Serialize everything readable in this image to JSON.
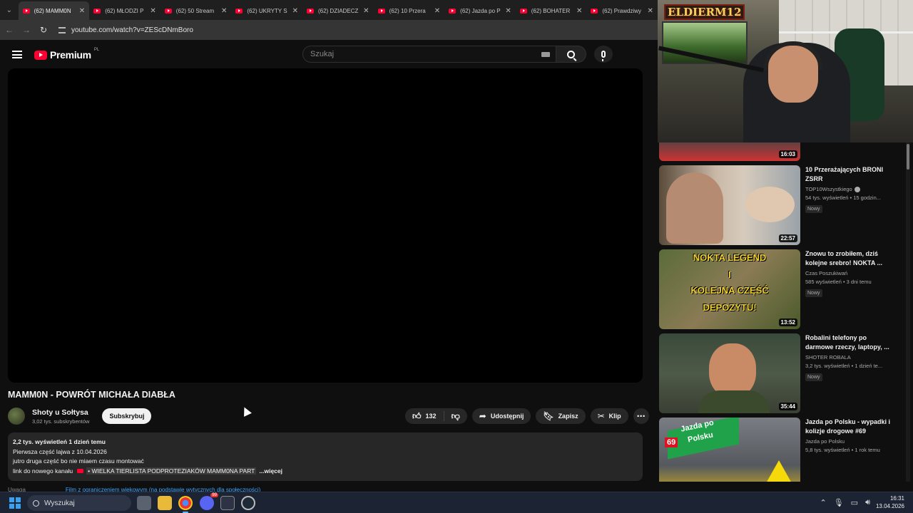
{
  "browser": {
    "tabs": [
      {
        "label": "(62) MAMM0N",
        "active": true
      },
      {
        "label": "(62) MŁODZI P",
        "active": false
      },
      {
        "label": "(62) 50 Stream",
        "active": false
      },
      {
        "label": "(62) UKRYTY S",
        "active": false
      },
      {
        "label": "(62) DZIADECZ",
        "active": false
      },
      {
        "label": "(62) 10 Przera",
        "active": false
      },
      {
        "label": "(62) Jazda po P",
        "active": false
      },
      {
        "label": "(62) BOHATER",
        "active": false
      },
      {
        "label": "(62) Prawdziwy",
        "active": false
      }
    ],
    "url": "youtube.com/watch?v=ZEScDNmBoro"
  },
  "masthead": {
    "logo_text": "Premium",
    "logo_country": "PL",
    "search_placeholder": "Szukaj"
  },
  "video": {
    "title": "MAMM0N - POWRÓT MICHAŁA DIABŁA",
    "channel_name": "Shoty u Sołtysa",
    "subscribers": "3,02 tys. subskrybentów",
    "subscribe_label": "Subskrybuj",
    "likes": "132",
    "share_label": "Udostępnij",
    "save_label": "Zapisz",
    "clip_label": "Klip"
  },
  "description": {
    "meta": "2,2 tys. wyświetleń  1 dzień temu",
    "line1": "Pierwsza część lajwa z 10.04.2026",
    "line2": "jutro druga część bo nie miaem czasu montować",
    "line3_prefix": "link do nowego kanału",
    "line3_tag": "• WIELKA TIERLISTA PODPROTEZIAKÓW MAMM0NA PART",
    "more": "...więcej"
  },
  "below": {
    "label": "Uwaga",
    "link": "Film z ograniczeniem wiekowym (na podstawie wytycznych dla społeczności)"
  },
  "webcam": {
    "watermark": "ELDIERM12"
  },
  "related": {
    "partial_duration": "16:03",
    "items": [
      {
        "title": "10 Przerażających BRONI ZSRR",
        "channel": "TOP10Wszystkiego",
        "verified": true,
        "meta": "54 tys. wyświetleń • 15 godzin...",
        "badge": "Nowy",
        "duration": "22:57"
      },
      {
        "title": "Znowu to zrobiłem, dziś kolejne srebro! NOKTA ...",
        "channel": "Czas Poszukiwań",
        "verified": false,
        "meta": "585 wyświetleń • 3 dni temu",
        "badge": "Nowy",
        "duration": "13:52",
        "thumb_text1": "NOKTA LEGEND",
        "thumb_text2": "I",
        "thumb_text3": "KOLEJNA CZĘŚĆ",
        "thumb_text4": "DEPOZYTU!"
      },
      {
        "title": "Robalini telefony po darmowe rzeczy, laptopy, ...",
        "channel": "SHOTER ROBALA",
        "verified": false,
        "meta": "3,2 tys. wyświetleń • 1 dzień te...",
        "badge": "Nowy",
        "duration": "35:44"
      },
      {
        "title": "Jazda po Polsku - wypadki i kolizje drogowe #69",
        "channel": "Jazda po Polsku",
        "verified": false,
        "meta": "5,8 tys. wyświetleń • 1 rok temu",
        "badge": "",
        "duration": "",
        "thumb_text1": "Jazda po",
        "thumb_text2": "Polsku",
        "thumb_num": "69"
      }
    ]
  },
  "taskbar": {
    "search_label": "Wyszukaj",
    "time": "16:31",
    "date": "13.04.2026",
    "badge_count": "99"
  },
  "colors": {
    "yt_red": "#ff0033",
    "bg": "#0f0f0f",
    "surface": "#272727",
    "link_blue": "#3ea6ff"
  }
}
